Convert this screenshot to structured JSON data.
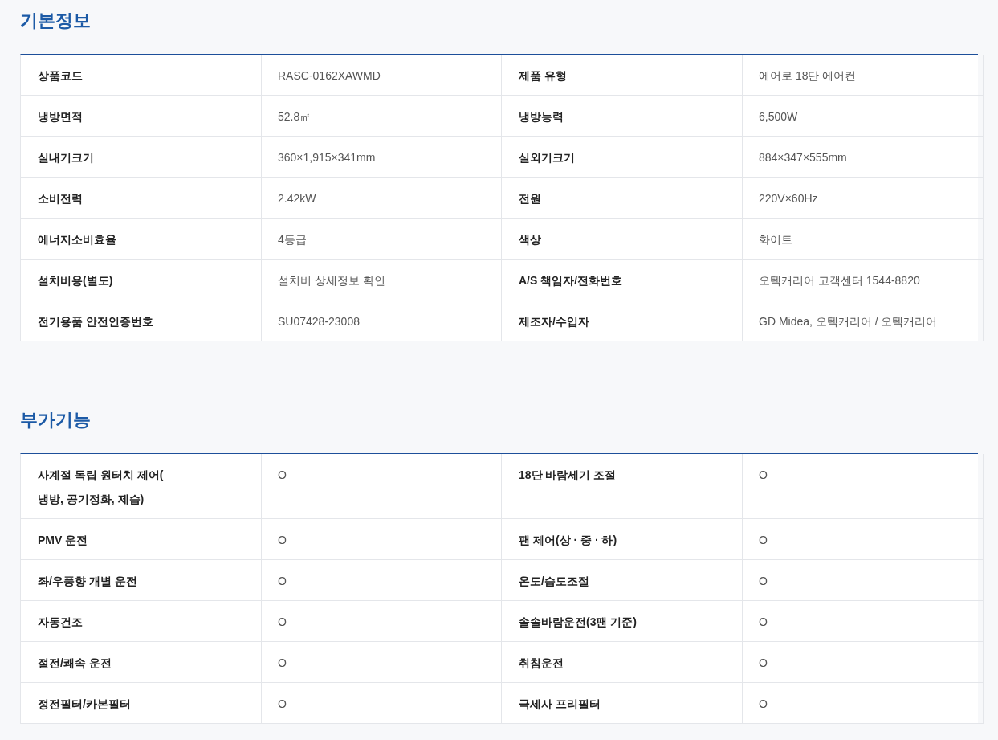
{
  "sections": [
    {
      "title": "기본정보",
      "items": [
        {
          "label": "상품코드",
          "value": "RASC-0162XAWMD"
        },
        {
          "label": "제품 유형",
          "value": "에어로 18단 에어컨"
        },
        {
          "label": "냉방면적",
          "value": "52.8㎡"
        },
        {
          "label": "냉방능력",
          "value": "6,500W"
        },
        {
          "label": "실내기크기",
          "value": "360×1,915×341mm"
        },
        {
          "label": "실외기크기",
          "value": "884×347×555mm"
        },
        {
          "label": "소비전력",
          "value": "2.42kW"
        },
        {
          "label": "전원",
          "value": "220V×60Hz"
        },
        {
          "label": "에너지소비효율",
          "value": "4등급"
        },
        {
          "label": "색상",
          "value": "화이트"
        },
        {
          "label": "설치비용(별도)",
          "value": "설치비 상세정보 확인"
        },
        {
          "label": "A/S 책임자/전화번호",
          "value": "오텍캐리어 고객센터 1544-8820"
        },
        {
          "label": "전기용품 안전인증번호",
          "value": "SU07428-23008"
        },
        {
          "label": "제조자/수입자",
          "value": "GD Midea, 오텍캐리어 / 오텍캐리어"
        }
      ]
    },
    {
      "title": "부가기능",
      "items": [
        {
          "label": "사계절 독립 원터치 제어(\n냉방, 공기정화, 제습)",
          "value": "O"
        },
        {
          "label": "18단 바람세기 조절",
          "value": "O"
        },
        {
          "label": "PMV 운전",
          "value": "O"
        },
        {
          "label": "팬 제어(상 · 중 · 하)",
          "value": "O"
        },
        {
          "label": "좌/우풍향 개별 운전",
          "value": "O"
        },
        {
          "label": "온도/습도조절",
          "value": "O"
        },
        {
          "label": "자동건조",
          "value": "O"
        },
        {
          "label": "솔솔바람운전(3팬 기준)",
          "value": "O"
        },
        {
          "label": "절전/쾌속 운전",
          "value": "O"
        },
        {
          "label": "취침운전",
          "value": "O"
        },
        {
          "label": "정전필터/카본필터",
          "value": "O"
        },
        {
          "label": "극세사 프리필터",
          "value": "O"
        }
      ]
    }
  ]
}
